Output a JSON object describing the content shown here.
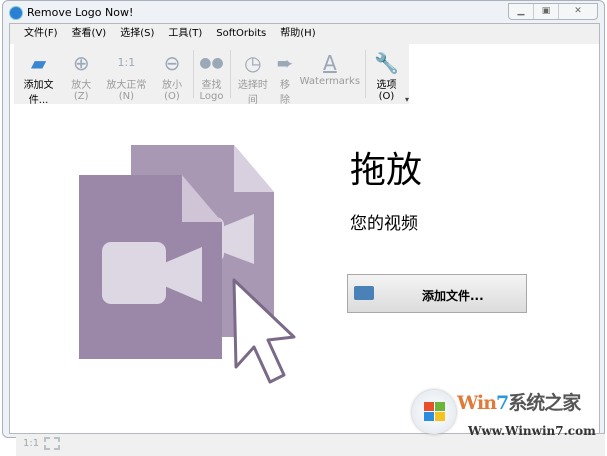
{
  "window": {
    "title": "Remove Logo Now!",
    "buttons": [
      "minimize",
      "maximize",
      "close"
    ]
  },
  "menu": [
    "文件(F)",
    "查看(V)",
    "选择(S)",
    "工具(T)",
    "SoftOrbits",
    "帮助(H)"
  ],
  "toolbar": [
    {
      "label": "添加文件...",
      "icon": "folder-icon",
      "enabled": true
    },
    {
      "label": "放大(Z)",
      "icon": "zoom-in-icon",
      "enabled": false
    },
    {
      "label": "放大正常(N)",
      "icon": "1:1",
      "enabled": false
    },
    {
      "label": "放小(O)",
      "icon": "zoom-out-icon",
      "enabled": false
    },
    {
      "label": "查找 Logo",
      "icon": "binoculars-icon",
      "enabled": false
    },
    {
      "label": "选择时间",
      "icon": "clock-icon",
      "enabled": false
    },
    {
      "label": "移除",
      "icon": "arrow-right-icon",
      "enabled": false
    },
    {
      "label": "Watermarks",
      "icon": "A",
      "enabled": false
    },
    {
      "label": "选项(O)",
      "icon": "wrench-icon",
      "enabled": true
    }
  ],
  "main": {
    "heading": "拖放",
    "subheading": "您的视频",
    "add_button": "添加文件..."
  },
  "status": {
    "zoom": "1:1"
  },
  "watermark": {
    "brand": "Win7系统之家",
    "url": "Www.Winwin7.com"
  },
  "colors": {
    "doc_front": "#9b88a8",
    "doc_back": "#a898b4"
  }
}
